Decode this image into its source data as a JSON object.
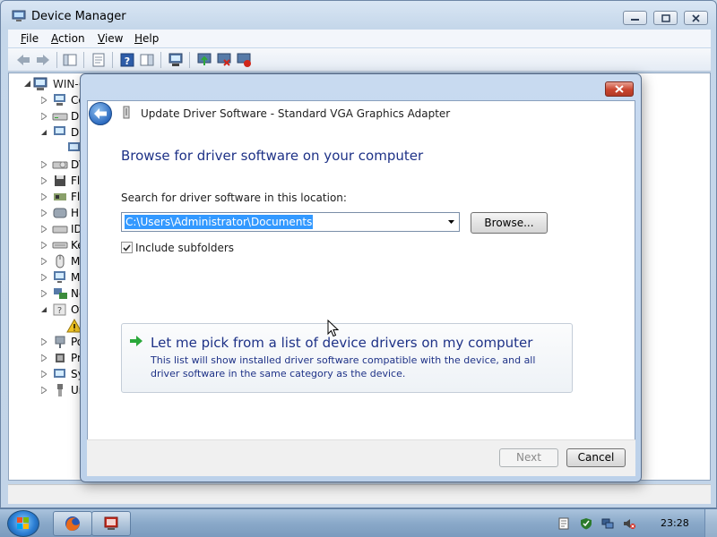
{
  "window": {
    "title": "Device Manager",
    "menu": [
      {
        "label": "File"
      },
      {
        "label": "Action"
      },
      {
        "label": "View"
      },
      {
        "label": "Help"
      }
    ]
  },
  "tree": {
    "root_label": "WIN-(",
    "items": [
      {
        "label": "Co"
      },
      {
        "label": "Di"
      },
      {
        "label": "Di"
      },
      {
        "label": ""
      },
      {
        "label": "DV"
      },
      {
        "label": "Fl"
      },
      {
        "label": "Fl"
      },
      {
        "label": "Hu"
      },
      {
        "label": "ID"
      },
      {
        "label": "Ke"
      },
      {
        "label": "M"
      },
      {
        "label": "M"
      },
      {
        "label": "Ne"
      },
      {
        "label": "Ot"
      },
      {
        "label": ""
      },
      {
        "label": "Po"
      },
      {
        "label": "Pr"
      },
      {
        "label": "Sy"
      },
      {
        "label": "Ur"
      }
    ]
  },
  "dialog": {
    "title": "Update Driver Software - Standard VGA Graphics Adapter",
    "heading": "Browse for driver software on your computer",
    "search_label": "Search for driver software in this location:",
    "path_value": "C:\\Users\\Administrator\\Documents",
    "browse_label": "Browse...",
    "include_subfolders_label": "Include subfolders",
    "include_subfolders_checked": true,
    "pick_title": "Let me pick from a list of device drivers on my computer",
    "pick_description": "This list will show installed driver software compatible with the device, and all driver software in the same category as the device.",
    "next_label": "Next",
    "cancel_label": "Cancel"
  },
  "taskbar": {
    "clock": "23:28"
  },
  "colors": {
    "heading": "#1e3287",
    "selection": "#3399ff",
    "close_button": "#c9452f"
  }
}
